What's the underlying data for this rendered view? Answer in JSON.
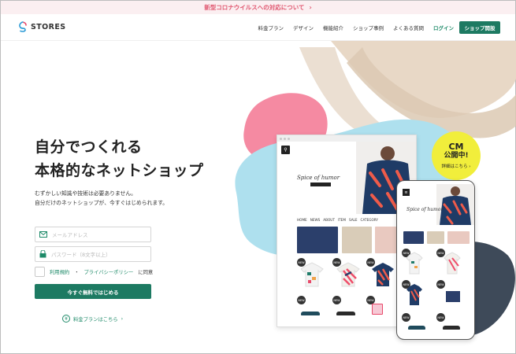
{
  "announcement": {
    "text": "新型コロナウイルスへの対応について",
    "chevron": "›"
  },
  "header": {
    "logo_text": "STORES",
    "nav": [
      "料金プラン",
      "デザイン",
      "機能紹介",
      "ショップ事例",
      "よくある質問",
      "ログイン"
    ],
    "cta_label": "ショップ開設"
  },
  "hero": {
    "headline_line1": "自分でつくれる",
    "headline_line2": "本格的なネットショップ",
    "sub_line1": "むずかしい知識や技術は必要ありません。",
    "sub_line2": "自分だけのネットショップが、今すぐはじめられます。"
  },
  "form": {
    "email_placeholder": "メールアドレス",
    "password_placeholder": "パスワード（8文字以上）",
    "agree_terms": "利用規約",
    "agree_separator": "・",
    "agree_privacy": "プライバシーポリシー",
    "agree_suffix": "に同意",
    "submit_label": "今すぐ無料ではじめる"
  },
  "pricing_link": {
    "label": "料金プランはこちら",
    "chevron": "›"
  },
  "cm_badge": {
    "line1": "CM",
    "line2": "公開中!",
    "line3": "詳細はこちら ›"
  },
  "mockup": {
    "brand": "Spice of humor",
    "menu": [
      "HOME",
      "NEWS",
      "ABOUT",
      "ITEM",
      "SALE",
      "CATEGORY"
    ],
    "new_badge": "NEW"
  },
  "colors": {
    "accent": "#1d7a62",
    "announce_bg": "#fbeff1",
    "announce_text": "#e0566f",
    "cm_yellow": "#f1ee3b",
    "blob_pink": "#f58aa2",
    "blob_blue": "#aee0ee",
    "blob_slate": "#3e4a59",
    "blob_beige": "#e8d8c6"
  },
  "icons": [
    "logo-icon",
    "mail-icon",
    "lock-icon",
    "yen-icon",
    "search-icon",
    "menu-icon"
  ]
}
